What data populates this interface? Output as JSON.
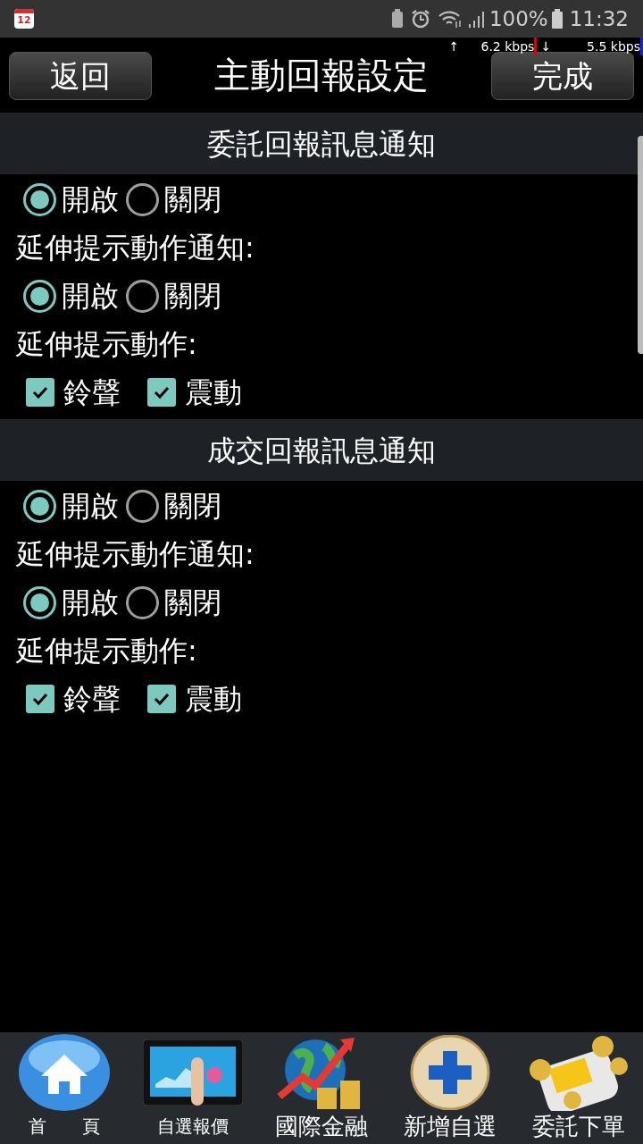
{
  "status_bar": {
    "date_badge": "12",
    "battery_percent": "100%",
    "time": "11:32"
  },
  "net_speed": {
    "up_arrow": "↑",
    "up": "6.2 kbps",
    "down_arrow": "↓",
    "down": "5.5 kbps"
  },
  "header": {
    "back": "返回",
    "title": "主動回報設定",
    "done": "完成"
  },
  "sections": [
    {
      "title": "委託回報訊息通知",
      "rows": [
        {
          "kind": "radio",
          "options": [
            {
              "label": "開啟",
              "selected": true
            },
            {
              "label": "關閉",
              "selected": false
            }
          ]
        },
        {
          "kind": "label",
          "text": "延伸提示動作通知:"
        },
        {
          "kind": "radio",
          "options": [
            {
              "label": "開啟",
              "selected": true
            },
            {
              "label": "關閉",
              "selected": false
            }
          ]
        },
        {
          "kind": "label",
          "text": "延伸提示動作:"
        },
        {
          "kind": "checkbox",
          "options": [
            {
              "label": "鈴聲",
              "checked": true
            },
            {
              "label": "震動",
              "checked": true
            }
          ]
        }
      ]
    },
    {
      "title": "成交回報訊息通知",
      "rows": [
        {
          "kind": "radio",
          "options": [
            {
              "label": "開啟",
              "selected": true
            },
            {
              "label": "關閉",
              "selected": false
            }
          ]
        },
        {
          "kind": "label",
          "text": "延伸提示動作通知:"
        },
        {
          "kind": "radio",
          "options": [
            {
              "label": "開啟",
              "selected": true
            },
            {
              "label": "關閉",
              "selected": false
            }
          ]
        },
        {
          "kind": "label",
          "text": "延伸提示動作:"
        },
        {
          "kind": "checkbox",
          "options": [
            {
              "label": "鈴聲",
              "checked": true
            },
            {
              "label": "震動",
              "checked": true
            }
          ]
        }
      ]
    }
  ],
  "bottom_nav": [
    {
      "kind": "home",
      "label": "首　　頁"
    },
    {
      "kind": "tablet",
      "label": "自選報價"
    },
    {
      "kind": "globe",
      "label": "國際金融"
    },
    {
      "kind": "plus",
      "label": "新增自選"
    },
    {
      "kind": "order",
      "label": "委託下單"
    }
  ]
}
